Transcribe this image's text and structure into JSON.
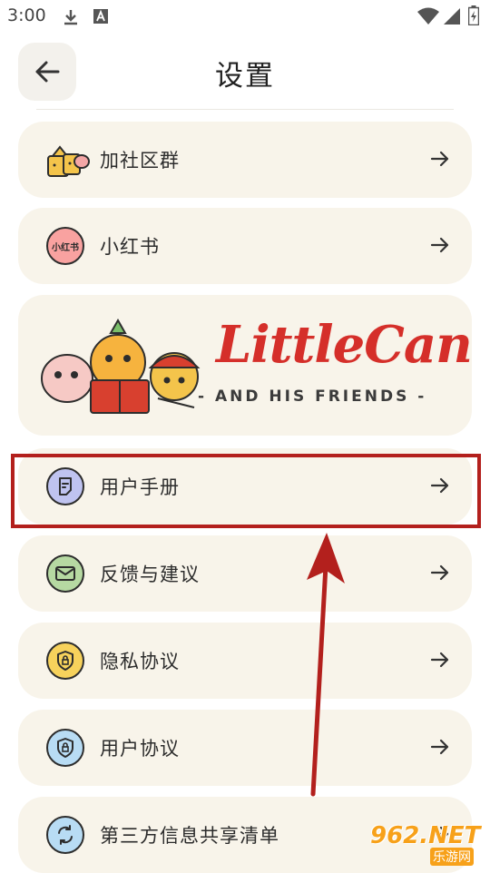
{
  "status_bar": {
    "time": "3:00",
    "icons": [
      "download-icon",
      "a-badge-icon",
      "wifi-icon",
      "signal-icon",
      "battery-icon"
    ]
  },
  "header": {
    "title": "设置",
    "back_icon": "arrow-left-icon"
  },
  "menu": {
    "items": [
      {
        "label": "加社区群",
        "icon": "community-cups-icon"
      },
      {
        "label": "小红书",
        "icon": "xiaohongshu-logo",
        "icon_text": "小红书",
        "icon_color": "#f9a2a0"
      },
      {
        "label": "用户手册",
        "icon": "manual-icon",
        "icon_color": "#bfc3f0"
      },
      {
        "label": "反馈与建议",
        "icon": "mail-icon",
        "icon_color": "#b6d9a2"
      },
      {
        "label": "隐私协议",
        "icon": "shield-lock-icon",
        "icon_color": "#f7d25c"
      },
      {
        "label": "用户协议",
        "icon": "shield-lock-icon",
        "icon_color": "#b8dcf4"
      },
      {
        "label": "第三方信息共享清单",
        "icon": "sync-arrows-icon",
        "icon_color": "#b8dcf4"
      }
    ],
    "arrow_icon": "arrow-right-icon"
  },
  "banner": {
    "brand": "LittleCan",
    "subtitle": "- AND HIS FRIENDS -"
  },
  "annotation": {
    "highlight_color": "#b3201d"
  },
  "watermark": {
    "brand": "962.NET",
    "sub": "乐游网"
  }
}
